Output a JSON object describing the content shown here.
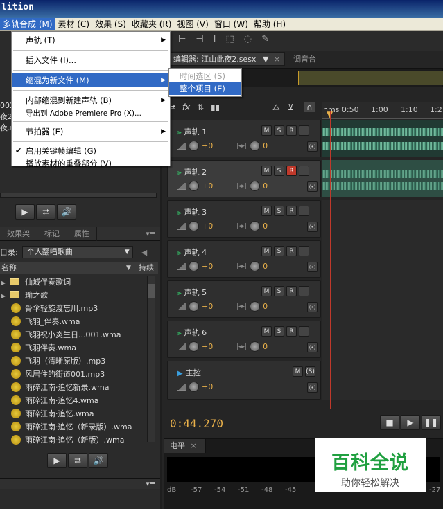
{
  "window": {
    "title": "lition"
  },
  "menubar": {
    "items": [
      "多轨合成 (M)",
      "素材 (C)",
      "效果 (S)",
      "收藏夹 (R)",
      "视图 (V)",
      "窗口 (W)",
      "帮助 (H)"
    ]
  },
  "dropdown": {
    "items": [
      {
        "label": "声轨 (T)",
        "arrow": "▶"
      },
      {
        "label": "插入文件 (I)...",
        "arrow": ""
      },
      {
        "label": "缩混为新文件 (M)",
        "arrow": "▶"
      },
      {
        "label": "内部缩混到新建声轨 (B)",
        "arrow": "▶"
      },
      {
        "label": "导出到 Adobe Premiere Pro (X)...",
        "arrow": ""
      },
      {
        "label": "节拍器 (E)",
        "arrow": "▶"
      },
      {
        "label": "启用关键帧编辑 (G)",
        "arrow": "",
        "check": "✔"
      },
      {
        "label": "播放素材的重叠部分 (V)",
        "arrow": ""
      }
    ]
  },
  "submenu": {
    "items": [
      "时间选区 (S)",
      "整个项目 (E)"
    ]
  },
  "left_top": {
    "clip1": "002",
    "clip2": "夜2.s",
    "clip3": "夜.m"
  },
  "left_bottom": {
    "tabs": [
      "效果架",
      "标记",
      "属性"
    ],
    "dir_label": "目录:",
    "dir_value": "个人翻唱歌曲",
    "col_name": "名称",
    "col_dur": "持续",
    "files": [
      {
        "name": "仙城伴奏歌词",
        "type": "folder"
      },
      {
        "name": "瑜之歌",
        "type": "folder"
      },
      {
        "name": "骨伞轻旋渡忘川.mp3",
        "type": "file"
      },
      {
        "name": "飞羽_伴奏.wma",
        "type": "file"
      },
      {
        "name": "飞羽祝小炎生日...001.wma",
        "type": "file"
      },
      {
        "name": "飞羽伴奏.wma",
        "type": "file"
      },
      {
        "name": "飞羽（清晰原版）.mp3",
        "type": "file"
      },
      {
        "name": "风居住的街道001.mp3",
        "type": "file"
      },
      {
        "name": "雨碎江南·追忆新录.wma",
        "type": "file"
      },
      {
        "name": "雨碎江南·追忆4.wma",
        "type": "file"
      },
      {
        "name": "雨碎江南·追忆.wma",
        "type": "file"
      },
      {
        "name": "雨碎江南·追忆（新录版）.wma",
        "type": "file"
      },
      {
        "name": "雨碎江南·追忆（新版）.wma",
        "type": "file"
      }
    ]
  },
  "editor": {
    "tab_label": "编辑器: 江山此夜2.sesx",
    "mixer_label": "调音台",
    "ruler": [
      "hms 0:50",
      "1:00",
      "1:10",
      "1:2"
    ],
    "tracks": [
      {
        "name": "声轨 1",
        "vol": "+0",
        "pan": "0",
        "record": false
      },
      {
        "name": "声轨 2",
        "vol": "+0",
        "pan": "0",
        "record": true
      },
      {
        "name": "声轨 3",
        "vol": "+0",
        "pan": "0",
        "record": false
      },
      {
        "name": "声轨 4",
        "vol": "+0",
        "pan": "0",
        "record": false
      },
      {
        "name": "声轨 5",
        "vol": "+0",
        "pan": "0",
        "record": false
      },
      {
        "name": "声轨 6",
        "vol": "+0",
        "pan": "0",
        "record": false
      }
    ],
    "master": {
      "name": "主控",
      "vol": "+0"
    },
    "time": "0:44.270"
  },
  "levels": {
    "label": "电平",
    "scale": [
      "dB",
      "-57",
      "-54",
      "-51",
      "-48",
      "-45",
      "-27"
    ]
  },
  "watermark": {
    "title": "百科全说",
    "subtitle": "助你轻松解决"
  },
  "colors": {
    "accent": "#316ac5",
    "time": "#e8b04a",
    "playhead": "#c0392b",
    "wave": "#5fa98c"
  }
}
